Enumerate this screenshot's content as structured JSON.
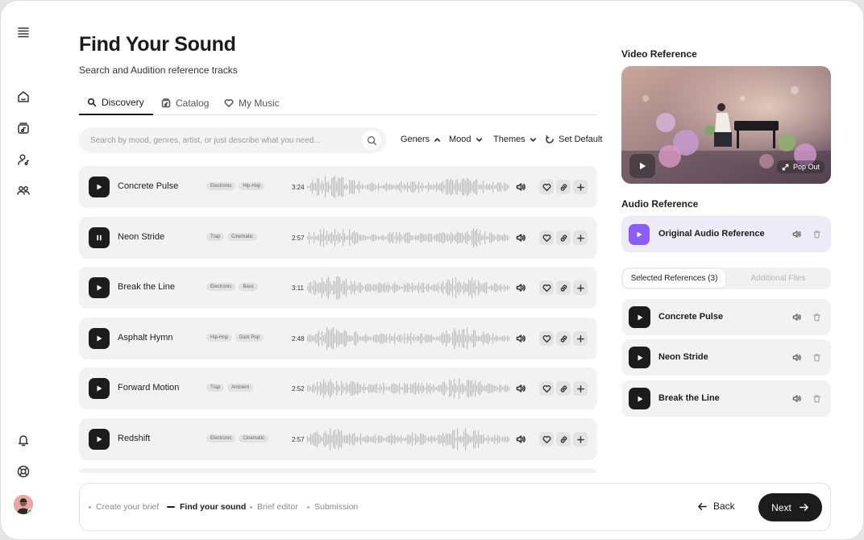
{
  "header": {
    "title": "Find Your Sound",
    "subtitle": "Search and Audition reference tracks"
  },
  "tabs": [
    {
      "label": "Discovery",
      "icon": "search-icon",
      "active": true
    },
    {
      "label": "Catalog",
      "icon": "catalog-icon",
      "active": false
    },
    {
      "label": "My Music",
      "icon": "heart-icon",
      "active": false
    }
  ],
  "search": {
    "placeholder": "Search by mood, genres, artist, or just describe what you need..."
  },
  "filters": {
    "genres": "Geners",
    "mood": "Mood",
    "themes": "Themes",
    "reset": "Set Default"
  },
  "tracks": [
    {
      "name": "Concrete Pulse",
      "tags": [
        "Electronic",
        "Hip-Hop"
      ],
      "duration": "3:24",
      "state": "paused"
    },
    {
      "name": "Neon Stride",
      "tags": [
        "Trap",
        "Cinematic"
      ],
      "duration": "2:57",
      "state": "playing"
    },
    {
      "name": "Break the Line",
      "tags": [
        "Electronic",
        "Bass"
      ],
      "duration": "3:11",
      "state": "paused"
    },
    {
      "name": "Asphalt Hymn",
      "tags": [
        "Hip-Hop",
        "Dark Pop"
      ],
      "duration": "2:48",
      "state": "paused"
    },
    {
      "name": "Forward Motion",
      "tags": [
        "Trap",
        "Ambient"
      ],
      "duration": "2:52",
      "state": "paused"
    },
    {
      "name": "Redshift",
      "tags": [
        "Electronic",
        "Cinematic"
      ],
      "duration": "2:57",
      "state": "paused"
    }
  ],
  "right_panel": {
    "video_heading": "Video Reference",
    "popout_label": "Pop Out",
    "audio_heading": "Audio Reference",
    "audio_name": "Original Audio Reference",
    "tab_selected": "Selected References (3)",
    "tab_additional": "Additional Files",
    "selected": [
      {
        "name": "Concrete Pulse"
      },
      {
        "name": "Neon Stride"
      },
      {
        "name": "Break the Line"
      }
    ]
  },
  "steps": [
    {
      "label": "Create your brief",
      "active": false
    },
    {
      "label": "Find your sound",
      "active": true
    },
    {
      "label": "Brief editor",
      "active": false
    },
    {
      "label": "Submission",
      "active": false
    }
  ],
  "nav": {
    "back": "Back",
    "next": "Next"
  },
  "colors": {
    "accent": "#8b5cf6",
    "dark": "#1c1c1c",
    "status_online": "#2fbf5c"
  }
}
